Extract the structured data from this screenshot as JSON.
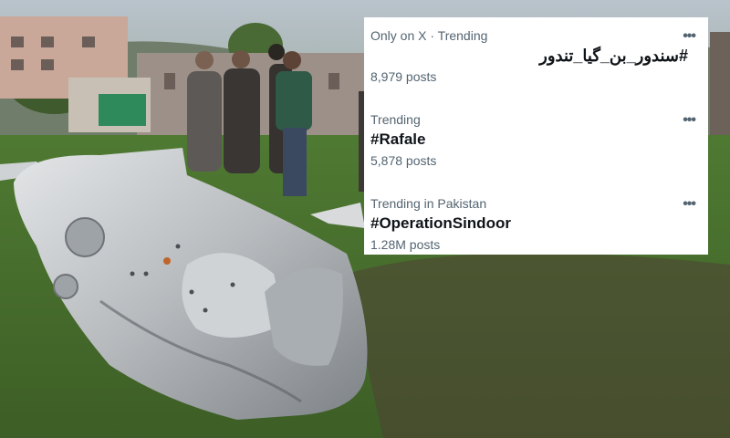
{
  "trends": [
    {
      "context": "Only on X · Trending",
      "tag": "#سندور_بن_گیا_تندور",
      "rtl": true,
      "count": "8,979 posts"
    },
    {
      "context": "Trending",
      "tag": "#Rafale",
      "rtl": false,
      "count": "5,878 posts"
    },
    {
      "context": "Trending in Pakistan",
      "tag": "#OperationSindoor",
      "rtl": false,
      "count": "1.28M posts"
    }
  ],
  "more_icon": "more-horizontal-icon",
  "more_glyph": "•••",
  "colors": {
    "card_bg": "#ffffff",
    "primary_text": "#0f1419",
    "secondary_text": "#536471"
  }
}
